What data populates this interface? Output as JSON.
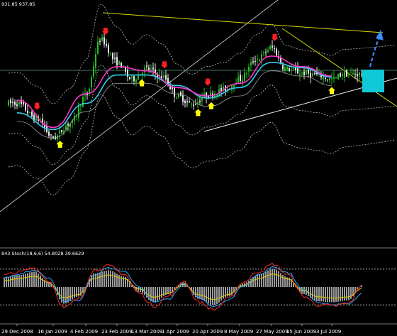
{
  "header": {
    "price_label": "931.85 937.85",
    "indicator_label": "843   Stoch(18,6,6) 54.8028 39.6629"
  },
  "colors": {
    "background": "#000000",
    "bull_candle": "#22c11e",
    "bear_candle": "#e8e8e8",
    "ema_fast": "#ff33cc",
    "ema_slow": "#33ccee",
    "sma": "#9a9a9a",
    "envelope": "#bdbdbd",
    "trendline": "#d8d800",
    "support": "#eeeeee",
    "arrow_down": "#ff2020",
    "arrow_up": "#ffff00",
    "target_box": "#10c8d8",
    "projection": "#3b8cff",
    "stoch_k": "#ff2a2a",
    "stoch_d": "#2aa8ff",
    "stoch_signal": "#e0d000",
    "histogram": "#9a9a9a"
  },
  "chart_data": [
    {
      "type": "candlestick",
      "title": "",
      "xlabel": "",
      "ylabel": "",
      "grid": false,
      "x_ticks": [
        "29 Dec 2008",
        "16 Jan 2009",
        "4 Feb 2009",
        "23 Feb 2009",
        "13 Mar 2009",
        "1 Apr 2009",
        "20 Apr 2009",
        "8 May 2009",
        "27 May 2009",
        "15 Jun 2009",
        "3 Jul 2009"
      ],
      "ylim": [
        780,
        990
      ],
      "series": [
        {
          "type": "price",
          "points": [
            {
              "x": "29 Dec 2008",
              "y": 905
            },
            {
              "x": "8 Jan 2009",
              "y": 890
            },
            {
              "x": "16 Jan 2009",
              "y": 872
            },
            {
              "x": "26 Jan 2009",
              "y": 886
            },
            {
              "x": "4 Feb 2009",
              "y": 912
            },
            {
              "x": "13 Feb 2009",
              "y": 966
            },
            {
              "x": "23 Feb 2009",
              "y": 944
            },
            {
              "x": "4 Mar 2009",
              "y": 928
            },
            {
              "x": "13 Mar 2009",
              "y": 938
            },
            {
              "x": "23 Mar 2009",
              "y": 930
            },
            {
              "x": "1 Apr 2009",
              "y": 912
            },
            {
              "x": "10 Apr 2009",
              "y": 904
            },
            {
              "x": "20 Apr 2009",
              "y": 913
            },
            {
              "x": "29 Apr 2009",
              "y": 918
            },
            {
              "x": "8 May 2009",
              "y": 928
            },
            {
              "x": "18 May 2009",
              "y": 947
            },
            {
              "x": "27 May 2009",
              "y": 958
            },
            {
              "x": "5 Jun 2009",
              "y": 938
            },
            {
              "x": "15 Jun 2009",
              "y": 934
            },
            {
              "x": "24 Jun 2009",
              "y": 932
            },
            {
              "x": "3 Jul 2009",
              "y": 928
            },
            {
              "x": "10 Jul 2009",
              "y": 933
            }
          ]
        },
        {
          "type": "ema_fast",
          "points": [
            {
              "x": "29 Dec 2008",
              "y": 908
            },
            {
              "x": "16 Jan 2009",
              "y": 882
            },
            {
              "x": "4 Feb 2009",
              "y": 914
            },
            {
              "x": "23 Feb 2009",
              "y": 940
            },
            {
              "x": "13 Mar 2009",
              "y": 936
            },
            {
              "x": "1 Apr 2009",
              "y": 920
            },
            {
              "x": "20 Apr 2009",
              "y": 912
            },
            {
              "x": "8 May 2009",
              "y": 924
            },
            {
              "x": "27 May 2009",
              "y": 950
            },
            {
              "x": "15 Jun 2009",
              "y": 940
            },
            {
              "x": "3 Jul 2009",
              "y": 931
            }
          ]
        },
        {
          "type": "ema_slow",
          "points": [
            {
              "x": "29 Dec 2008",
              "y": 896
            },
            {
              "x": "16 Jan 2009",
              "y": 880
            },
            {
              "x": "4 Feb 2009",
              "y": 905
            },
            {
              "x": "23 Feb 2009",
              "y": 932
            },
            {
              "x": "13 Mar 2009",
              "y": 932
            },
            {
              "x": "1 Apr 2009",
              "y": 922
            },
            {
              "x": "20 Apr 2009",
              "y": 910
            },
            {
              "x": "8 May 2009",
              "y": 920
            },
            {
              "x": "27 May 2009",
              "y": 944
            },
            {
              "x": "15 Jun 2009",
              "y": 939
            },
            {
              "x": "3 Jul 2009",
              "y": 930
            }
          ]
        }
      ],
      "annotations": {
        "down_arrows": [
          "8 Jan 2009",
          "16 Feb 2009",
          "24 Mar 2009",
          "20 Apr 2009",
          "29 May 2009"
        ],
        "up_arrows": [
          "20 Jan 2009",
          "10 Mar 2009",
          "14 Apr 2009",
          "22 Apr 2009",
          "3 Jul 2009"
        ]
      }
    },
    {
      "type": "line",
      "title": "",
      "xlabel": "",
      "ylabel": "",
      "ylim": [
        0,
        100
      ],
      "levels": [
        80,
        20
      ],
      "series": [
        {
          "values": [
            70,
            75,
            82,
            60,
            15,
            30,
            78,
            85,
            72,
            40,
            18,
            35,
            60,
            25,
            12,
            30,
            58,
            76,
            88,
            70,
            35,
            20,
            18,
            22,
            54.8
          ]
        },
        {
          "values": [
            65,
            72,
            78,
            65,
            25,
            28,
            70,
            82,
            76,
            50,
            25,
            30,
            55,
            32,
            18,
            28,
            52,
            70,
            84,
            74,
            45,
            25,
            20,
            22,
            39.7
          ]
        }
      ]
    }
  ]
}
